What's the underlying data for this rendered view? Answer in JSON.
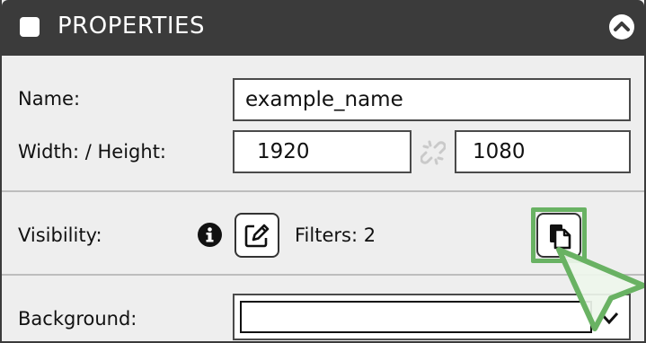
{
  "panel": {
    "title": "PROPERTIES"
  },
  "form": {
    "name_label": "Name:",
    "name_value": "example_name",
    "size_label": "Width: / Height:",
    "width_value": "1920",
    "height_value": "1080",
    "visibility_label": "Visibility:",
    "filters_label": "Filters: 2",
    "background_label": "Background:"
  },
  "colors": {
    "header": "#3b3b3b",
    "panel_bg": "#eeeeee",
    "highlight": "#69b263"
  },
  "icons": [
    "checkbox-icon",
    "chevron-up-icon",
    "link-broken-icon",
    "info-icon",
    "edit-icon",
    "copy-icon",
    "pointer-cursor-icon",
    "chevron-down-icon"
  ]
}
